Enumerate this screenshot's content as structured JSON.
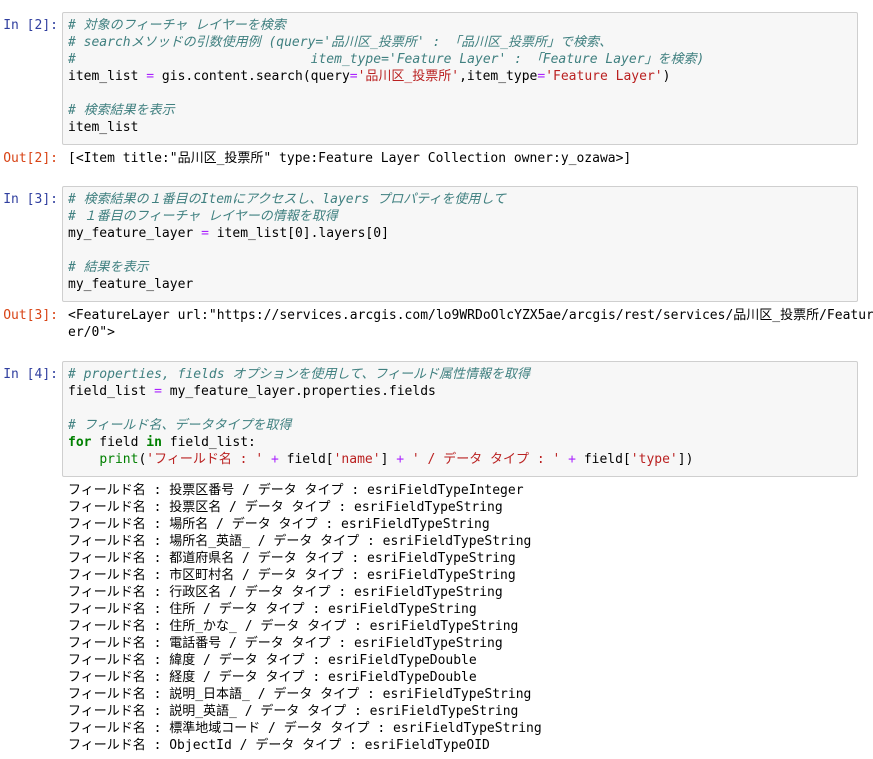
{
  "cells": [
    {
      "in_prompt": "In [2]:",
      "code": [
        [
          {
            "t": "cm",
            "v": "# 対象のフィーチャ レイヤーを検索"
          }
        ],
        [
          {
            "t": "cm",
            "v": "# searchメソッドの引数使用例 (query='品川区_投票所' : 「品川区_投票所」で検索、"
          }
        ],
        [
          {
            "t": "cm",
            "v": "#                              item_type='Feature Layer' : 「Feature Layer」を検索)"
          }
        ],
        [
          {
            "t": "nm",
            "v": "item_list "
          },
          {
            "t": "op",
            "v": "="
          },
          {
            "t": "nm",
            "v": " gis.content.search(query"
          },
          {
            "t": "op",
            "v": "="
          },
          {
            "t": "str",
            "v": "'品川区_投票所'"
          },
          {
            "t": "nm",
            "v": ",item_type"
          },
          {
            "t": "op",
            "v": "="
          },
          {
            "t": "str",
            "v": "'Feature Layer'"
          },
          {
            "t": "nm",
            "v": ")"
          }
        ],
        [],
        [
          {
            "t": "cm",
            "v": "# 検索結果を表示"
          }
        ],
        [
          {
            "t": "nm",
            "v": "item_list"
          }
        ]
      ],
      "out_prompt": "Out[2]:",
      "output": [
        "[<Item title:\"品川区_投票所\" type:Feature Layer Collection owner:y_ozawa>]"
      ]
    },
    {
      "in_prompt": "In [3]:",
      "code": [
        [
          {
            "t": "cm",
            "v": "# 検索結果の１番目のItemにアクセスし、layers プロパティを使用して"
          }
        ],
        [
          {
            "t": "cm",
            "v": "# １番目のフィーチャ レイヤーの情報を取得"
          }
        ],
        [
          {
            "t": "nm",
            "v": "my_feature_layer "
          },
          {
            "t": "op",
            "v": "="
          },
          {
            "t": "nm",
            "v": " item_list[0].layers[0]"
          }
        ],
        [],
        [
          {
            "t": "cm",
            "v": "# 結果を表示"
          }
        ],
        [
          {
            "t": "nm",
            "v": "my_feature_layer"
          }
        ]
      ],
      "out_prompt": "Out[3]:",
      "output": [
        "<FeatureLayer url:\"https://services.arcgis.com/lo9WRDoOlcYZX5ae/arcgis/rest/services/品川区_投票所/FeatureServ",
        "er/0\">"
      ]
    },
    {
      "in_prompt": "In [4]:",
      "code": [
        [
          {
            "t": "cm",
            "v": "# properties, fields オプションを使用して、フィールド属性情報を取得"
          }
        ],
        [
          {
            "t": "nm",
            "v": "field_list "
          },
          {
            "t": "op",
            "v": "="
          },
          {
            "t": "nm",
            "v": " my_feature_layer.properties.fields"
          }
        ],
        [],
        [
          {
            "t": "cm",
            "v": "# フィールド名、データタイプを取得"
          }
        ],
        [
          {
            "t": "kw",
            "v": "for"
          },
          {
            "t": "nm",
            "v": " field "
          },
          {
            "t": "kw",
            "v": "in"
          },
          {
            "t": "nm",
            "v": " field_list:"
          }
        ],
        [
          {
            "t": "nm",
            "v": "    "
          },
          {
            "t": "bi",
            "v": "print"
          },
          {
            "t": "nm",
            "v": "("
          },
          {
            "t": "str",
            "v": "'フィールド名 : '"
          },
          {
            "t": "nm",
            "v": " "
          },
          {
            "t": "op",
            "v": "+"
          },
          {
            "t": "nm",
            "v": " field["
          },
          {
            "t": "str",
            "v": "'name'"
          },
          {
            "t": "nm",
            "v": "] "
          },
          {
            "t": "op",
            "v": "+"
          },
          {
            "t": "nm",
            "v": " "
          },
          {
            "t": "str",
            "v": "' / データ タイプ : '"
          },
          {
            "t": "nm",
            "v": " "
          },
          {
            "t": "op",
            "v": "+"
          },
          {
            "t": "nm",
            "v": " field["
          },
          {
            "t": "str",
            "v": "'type'"
          },
          {
            "t": "nm",
            "v": "])"
          }
        ]
      ],
      "out_prompt": "",
      "output": [
        "フィールド名 : 投票区番号 / データ タイプ : esriFieldTypeInteger",
        "フィールド名 : 投票区名 / データ タイプ : esriFieldTypeString",
        "フィールド名 : 場所名 / データ タイプ : esriFieldTypeString",
        "フィールド名 : 場所名_英語_ / データ タイプ : esriFieldTypeString",
        "フィールド名 : 都道府県名 / データ タイプ : esriFieldTypeString",
        "フィールド名 : 市区町村名 / データ タイプ : esriFieldTypeString",
        "フィールド名 : 行政区名 / データ タイプ : esriFieldTypeString",
        "フィールド名 : 住所 / データ タイプ : esriFieldTypeString",
        "フィールド名 : 住所_かな_ / データ タイプ : esriFieldTypeString",
        "フィールド名 : 電話番号 / データ タイプ : esriFieldTypeString",
        "フィールド名 : 緯度 / データ タイプ : esriFieldTypeDouble",
        "フィールド名 : 経度 / データ タイプ : esriFieldTypeDouble",
        "フィールド名 : 説明_日本語_ / データ タイプ : esriFieldTypeString",
        "フィールド名 : 説明_英語_ / データ タイプ : esriFieldTypeString",
        "フィールド名 : 標準地域コード / データ タイプ : esriFieldTypeString",
        "フィールド名 : ObjectId / データ タイプ : esriFieldTypeOID"
      ]
    }
  ]
}
